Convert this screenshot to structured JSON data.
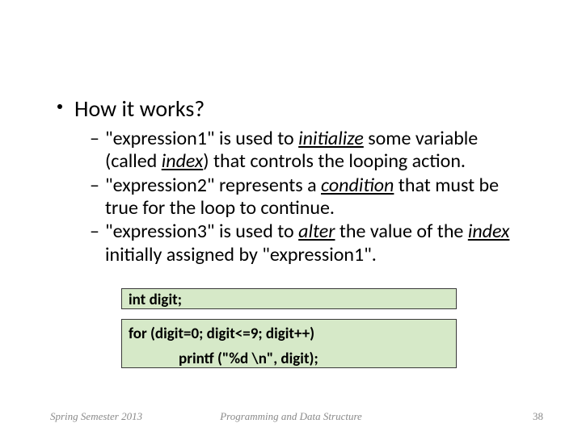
{
  "main_bullet": "How it works?",
  "sub": [
    {
      "pre": "\"expression1\" is used to ",
      "it1": "initialize",
      "mid1": " some variable (called ",
      "it2": "index",
      "mid2": ") that controls the looping action."
    },
    {
      "pre": "\"expression2\" represents a ",
      "it1": "condition",
      "mid1": " that must be true for the loop to continue."
    },
    {
      "pre": "\"expression3\" is used to ",
      "it1": "alter",
      "mid1": " the value of the ",
      "it2": "index",
      "mid2": " initially assigned by \"expression1\"."
    }
  ],
  "code": {
    "decl": "int  digit;",
    "forline": "for  (digit=0;  digit<=9;  digit++)",
    "body": "printf (\"%d \\n\", digit);"
  },
  "footer": {
    "left": "Spring Semester 2013",
    "center": "Programming and Data Structure",
    "page": "38"
  }
}
